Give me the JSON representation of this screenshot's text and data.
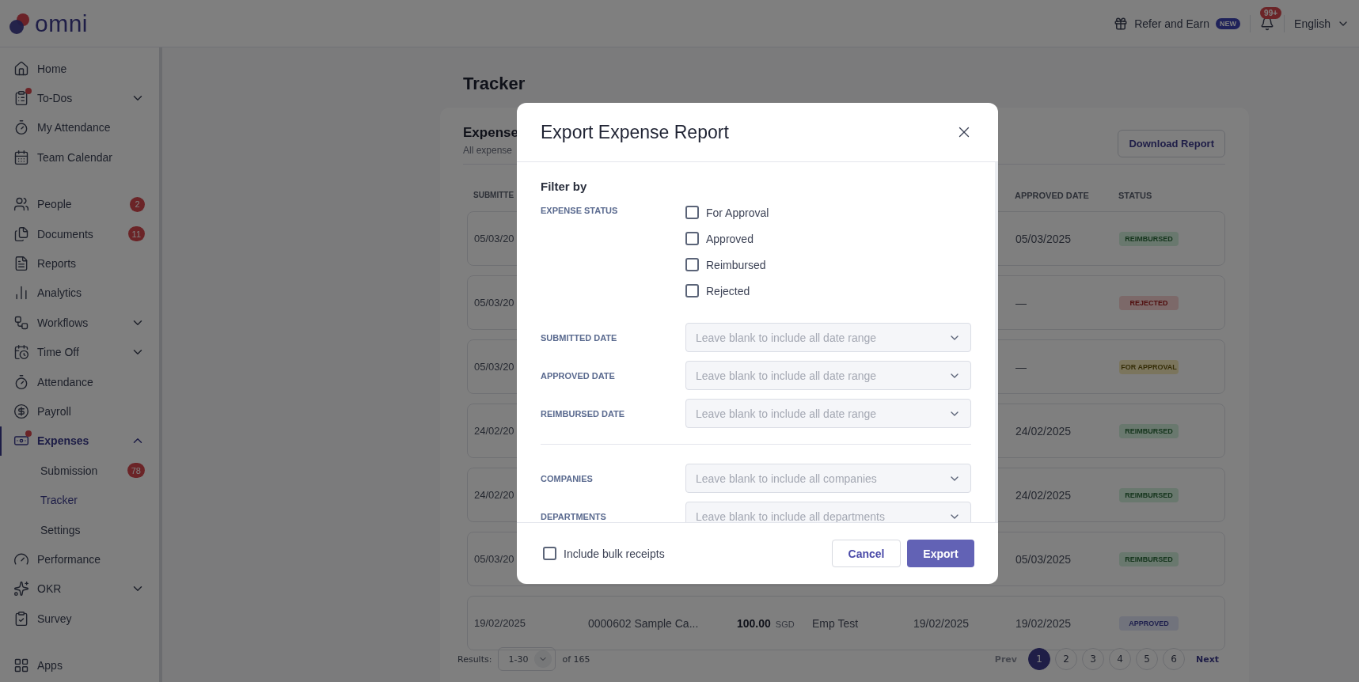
{
  "header": {
    "logo": "omni",
    "refer": {
      "label": "Refer and Earn",
      "badge": "NEW"
    },
    "notifications": {
      "badge": "99+"
    },
    "language": "English"
  },
  "sidebar": {
    "groups": [
      {
        "items": [
          {
            "label": "Home",
            "selected": false
          },
          {
            "label": "To-Dos",
            "selected": false,
            "dot": true,
            "expanded": false
          },
          {
            "label": "My Attendance",
            "selected": false
          },
          {
            "label": "Team Calendar",
            "selected": false
          }
        ]
      },
      {
        "items": [
          {
            "label": "People",
            "selected": false,
            "badge": "2"
          },
          {
            "label": "Documents",
            "selected": false,
            "badge": "11"
          },
          {
            "label": "Reports",
            "selected": false
          },
          {
            "label": "Analytics",
            "selected": false
          },
          {
            "label": "Workflows",
            "selected": false,
            "expanded": false
          },
          {
            "label": "Time Off",
            "selected": false,
            "expanded": false
          },
          {
            "label": "Attendance",
            "selected": false
          },
          {
            "label": "Payroll",
            "selected": false
          },
          {
            "label": "Expenses",
            "selected": true,
            "dot": true,
            "expanded": true,
            "children": [
              {
                "label": "Submission",
                "selected": false,
                "badge": "78"
              },
              {
                "label": "Tracker",
                "selected": true
              },
              {
                "label": "Settings",
                "selected": false
              }
            ]
          },
          {
            "label": "Performance",
            "selected": false
          },
          {
            "label": "OKR",
            "selected": false,
            "expanded": false
          },
          {
            "label": "Survey",
            "selected": false
          }
        ]
      },
      {
        "items": [
          {
            "label": "Apps",
            "selected": false
          }
        ]
      }
    ]
  },
  "page": {
    "title": "Tracker",
    "card": {
      "title": "Expense",
      "subtitle": "All expense",
      "download": "Download Report",
      "columns": {
        "first": "SUBMITTE",
        "approved_date": "APPROVED DATE",
        "status": "STATUS"
      },
      "rows": [
        {
          "submitted": "05/03/20",
          "approved_date": "05/03/2025",
          "status": {
            "label": "REIMBURSED",
            "kind": "reimbursed"
          }
        },
        {
          "submitted": "05/03/20",
          "approved_date": "—",
          "status": {
            "label": "REJECTED",
            "kind": "rejected"
          }
        },
        {
          "submitted": "05/03/20",
          "approved_date": "—",
          "status": {
            "label": "FOR APPROVAL",
            "kind": "for_approval"
          }
        },
        {
          "submitted": "24/02/20",
          "approved_date": "24/02/2025",
          "status": {
            "label": "REIMBURSED",
            "kind": "reimbursed"
          }
        },
        {
          "submitted": "24/02/20",
          "approved_date": "24/02/2025",
          "status": {
            "label": "REIMBURSED",
            "kind": "reimbursed"
          }
        },
        {
          "submitted": "05/03/20",
          "approved_date": "05/03/2025",
          "status": {
            "label": "REIMBURSED",
            "kind": "reimbursed"
          }
        },
        {
          "submitted": "19/02/2025",
          "details": "0000602 Sample Ca...",
          "amount": "100.00",
          "currency": "SGD",
          "employee": "Emp Test",
          "submitted_date": "19/02/2025",
          "approved_date": "19/02/2025",
          "status": {
            "label": "APPROVED",
            "kind": "approved"
          }
        }
      ]
    },
    "pagination": {
      "results_label": "Results:",
      "range": "1-30",
      "total": "of 165",
      "prev": {
        "label": "Prev",
        "disabled": true
      },
      "pages": [
        {
          "label": "1",
          "selected": true
        },
        {
          "label": "2",
          "selected": false
        },
        {
          "label": "3",
          "selected": false
        },
        {
          "label": "4",
          "selected": false
        },
        {
          "label": "5",
          "selected": false
        },
        {
          "label": "6",
          "selected": false
        }
      ],
      "next": {
        "label": "Next",
        "disabled": false
      }
    }
  },
  "modal": {
    "title": "Export Expense Report",
    "filter_heading": "Filter by",
    "status_filter": {
      "label": "EXPENSE STATUS",
      "options": [
        {
          "label": "For Approval",
          "checked": false
        },
        {
          "label": "Approved",
          "checked": false
        },
        {
          "label": "Reimbursed",
          "checked": false
        },
        {
          "label": "Rejected",
          "checked": false
        }
      ]
    },
    "date_filters": [
      {
        "label": "SUBMITTED DATE",
        "placeholder": "Leave blank to include all date range"
      },
      {
        "label": "APPROVED DATE",
        "placeholder": "Leave blank to include all date range"
      },
      {
        "label": "REIMBURSED DATE",
        "placeholder": "Leave blank to include all date range"
      }
    ],
    "org_filters": [
      {
        "label": "COMPANIES",
        "placeholder": "Leave blank to include all companies"
      },
      {
        "label": "DEPARTMENTS",
        "placeholder": "Leave blank to include all departments"
      }
    ],
    "bulk_receipts": {
      "label": "Include bulk receipts",
      "checked": false
    },
    "cancel": "Cancel",
    "export": "Export"
  }
}
